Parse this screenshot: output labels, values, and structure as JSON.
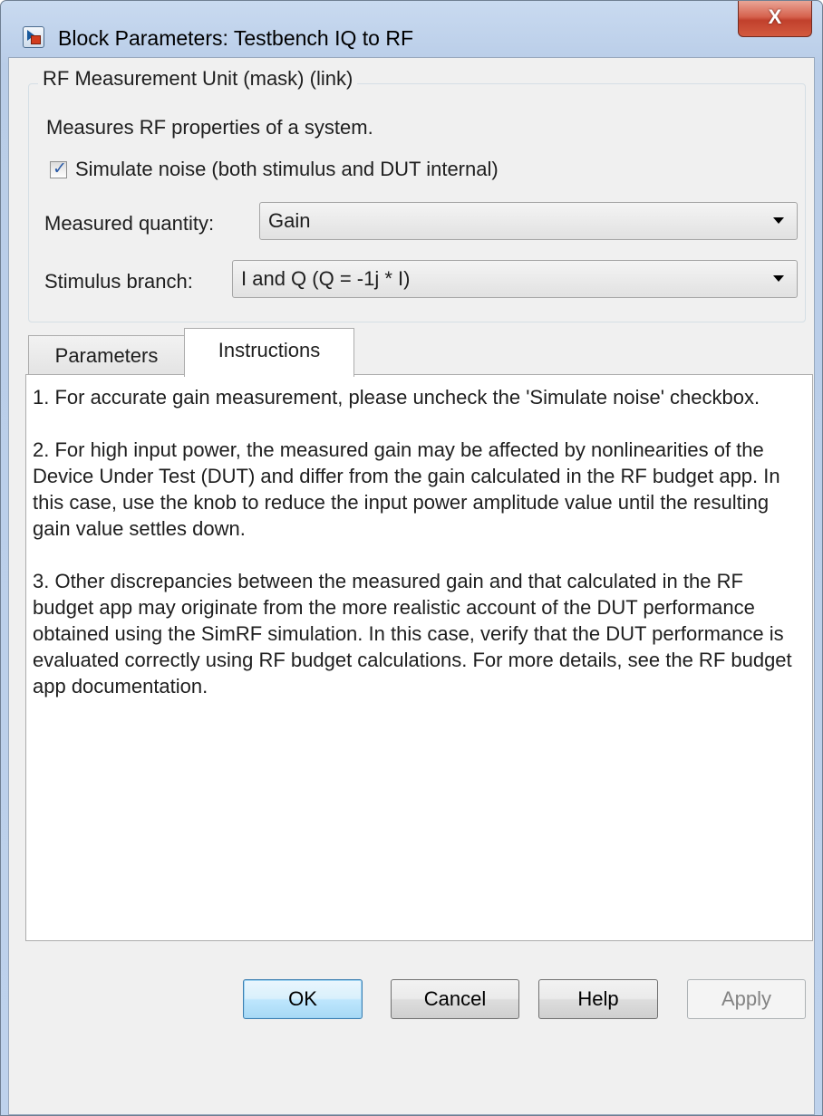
{
  "window": {
    "title": "Block Parameters: Testbench IQ to RF",
    "close_glyph": "X"
  },
  "mask": {
    "group_title": "RF Measurement Unit (mask) (link)",
    "description": "Measures RF properties of a system.",
    "simulate_noise": {
      "label": "Simulate noise (both stimulus and DUT internal)",
      "checked": true
    },
    "measured_quantity": {
      "label": "Measured quantity:",
      "value": "Gain"
    },
    "stimulus_branch": {
      "label": "Stimulus branch:",
      "value": "I and Q (Q = -1j * I)"
    }
  },
  "tabs": [
    {
      "label": "Parameters",
      "active": false
    },
    {
      "label": "Instructions",
      "active": true
    }
  ],
  "instructions": [
    "1. For accurate gain measurement, please uncheck the 'Simulate noise' checkbox.",
    "2. For high input power, the measured gain may be affected by nonlinearities of the Device Under Test (DUT) and differ from the gain calculated in the RF budget app. In this case, use the knob to reduce the input power amplitude value until the resulting gain value settles down.",
    "3. Other discrepancies between the measured gain and that calculated in the RF budget app may originate from the more realistic account of the DUT performance obtained using the SimRF simulation. In this case, verify that the DUT performance is evaluated correctly using RF budget calculations. For more details, see the RF budget app documentation."
  ],
  "buttons": {
    "ok": "OK",
    "cancel": "Cancel",
    "help": "Help",
    "apply": "Apply",
    "apply_enabled": false
  },
  "icons": {
    "app": "simulink-block-icon",
    "close": "close-icon",
    "checkbox": "checkmark-icon",
    "dropdown": "chevron-down-icon"
  },
  "colors": {
    "title_bar": "#c9daf0",
    "close_button": "#c1402c",
    "dialog_background": "#f0f0f0",
    "default_button": "#bee6fd",
    "checkmark": "#2a5aa6"
  }
}
